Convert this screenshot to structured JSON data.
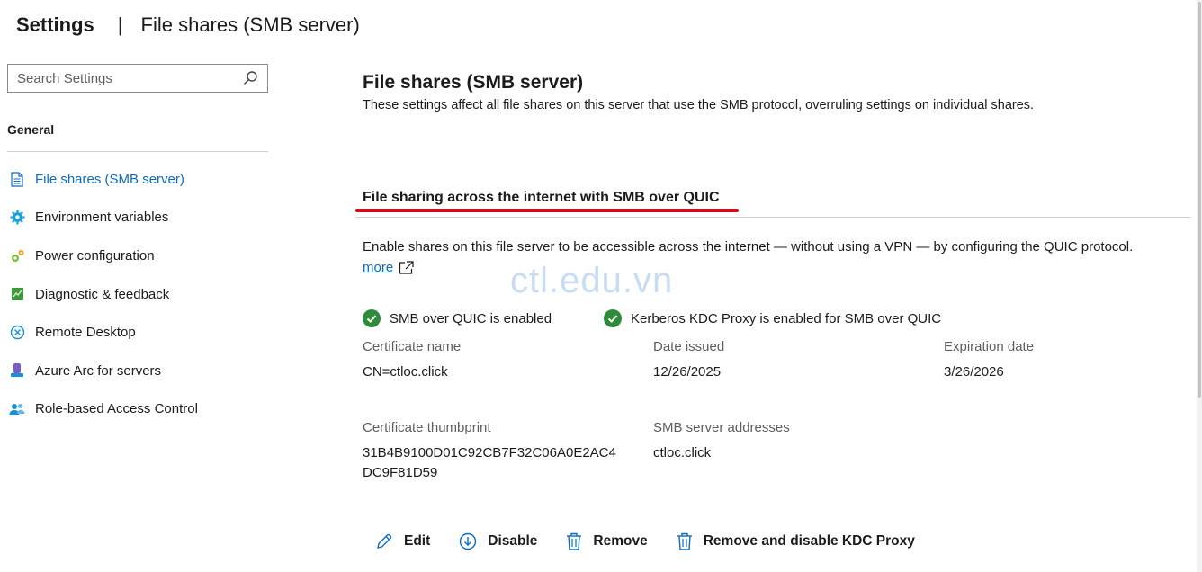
{
  "header": {
    "title": "Settings",
    "separator": "|",
    "subtitle": "File shares (SMB server)"
  },
  "search": {
    "placeholder": "Search Settings",
    "value": ""
  },
  "sidebar": {
    "group": "General",
    "items": [
      {
        "label": "File shares (SMB server)",
        "icon": "document-icon",
        "active": true
      },
      {
        "label": "Environment variables",
        "icon": "gear-icon"
      },
      {
        "label": "Power configuration",
        "icon": "power-gear-icon"
      },
      {
        "label": "Diagnostic & feedback",
        "icon": "diagnostic-chart-icon"
      },
      {
        "label": "Remote Desktop",
        "icon": "remote-desktop-icon"
      },
      {
        "label": "Azure Arc for servers",
        "icon": "azure-arc-icon"
      },
      {
        "label": "Role-based Access Control",
        "icon": "users-icon"
      }
    ]
  },
  "main": {
    "title": "File shares (SMB server)",
    "description": "These settings affect all file shares on this server that use the SMB protocol, overruling settings on individual shares.",
    "section_title": "File sharing across the internet with SMB over QUIC",
    "enable_description": "Enable shares on this file server to be accessible across the internet — without using a VPN — by configuring the QUIC protocol.",
    "more_link": "more",
    "watermark": "ctl.edu.vn",
    "status": [
      {
        "label": "SMB over QUIC is enabled",
        "icon": "check-circle-icon"
      },
      {
        "label": "Kerberos KDC Proxy is enabled for SMB over QUIC",
        "icon": "check-circle-icon"
      }
    ],
    "fields": {
      "certificate_name": {
        "label": "Certificate name",
        "value": "CN=ctloc.click"
      },
      "date_issued": {
        "label": "Date issued",
        "value": "12/26/2025"
      },
      "expiration_date": {
        "label": "Expiration date",
        "value": "3/26/2026"
      },
      "certificate_thumbprint": {
        "label": "Certificate thumbprint",
        "value": "31B4B9100D01C92CB7F32C06A0E2AC4DC9F81D59"
      },
      "smb_server_addresses": {
        "label": "SMB server addresses",
        "value": "ctloc.click"
      }
    },
    "actions": {
      "edit": "Edit",
      "disable": "Disable",
      "remove": "Remove",
      "remove_disable_kdc": "Remove and disable KDC Proxy"
    }
  },
  "colors": {
    "accent": "#0f6cbd",
    "success": "#107c10",
    "highlight_underline": "#d40c1a",
    "watermark": "#c9dcf0"
  }
}
